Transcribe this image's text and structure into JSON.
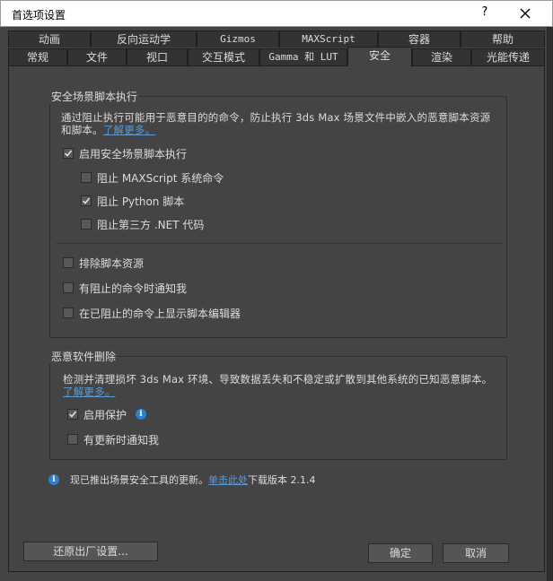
{
  "window": {
    "title": "首选项设置",
    "help_label": "?"
  },
  "tabs_row1": [
    {
      "label": "动画"
    },
    {
      "label": "反向运动学"
    },
    {
      "label": "Gizmos"
    },
    {
      "label": "MAXScript"
    },
    {
      "label": "容器"
    },
    {
      "label": "帮助"
    }
  ],
  "tabs_row2": [
    {
      "label": "常规"
    },
    {
      "label": "文件"
    },
    {
      "label": "视口"
    },
    {
      "label": "交互模式"
    },
    {
      "label": "Gamma 和 LUT"
    },
    {
      "label": "安全"
    },
    {
      "label": "渲染"
    },
    {
      "label": "光能传递"
    }
  ],
  "active_tab": "安全",
  "safe_scene": {
    "title": "安全场景脚本执行",
    "desc": "通过阻止执行可能用于恶意目的的命令，防止执行 3ds Max 场景文件中嵌入的恶意脚本资源和脚本。",
    "learn_more": "了解更多。",
    "enable": {
      "label": "启用安全场景脚本执行",
      "checked": true
    },
    "block_maxscript": {
      "label": "阻止 MAXScript 系统命令",
      "checked": false
    },
    "block_python": {
      "label": "阻止 Python 脚本",
      "checked": true
    },
    "block_dotnet": {
      "label": "阻止第三方 .NET 代码",
      "checked": false
    },
    "exclude_resources": {
      "label": "排除脚本资源",
      "checked": false
    },
    "notify_blocked": {
      "label": "有阻止的命令时通知我",
      "checked": false
    },
    "show_editor": {
      "label": "在已阻止的命令上显示脚本编辑器",
      "checked": false
    }
  },
  "malware": {
    "title": "恶意软件删除",
    "desc": "检测并清理损坏 3ds Max 环境、导致数据丢失和不稳定或扩散到其他系统的已知恶意脚本。",
    "learn_more": "了解更多。",
    "enable_protection": {
      "label": "启用保护",
      "checked": true
    },
    "notify_updates": {
      "label": "有更新时通知我",
      "checked": false
    }
  },
  "footer_note": {
    "text": "现已推出场景安全工具的更新。",
    "link": "单击此处",
    "suffix": "下载版本 2.1.4"
  },
  "buttons": {
    "reset": "还原出厂设置...",
    "ok": "确定",
    "cancel": "取消"
  },
  "colors": {
    "accent": "#2d7fd2",
    "link": "#5b9bd5",
    "panel": "#444444"
  }
}
